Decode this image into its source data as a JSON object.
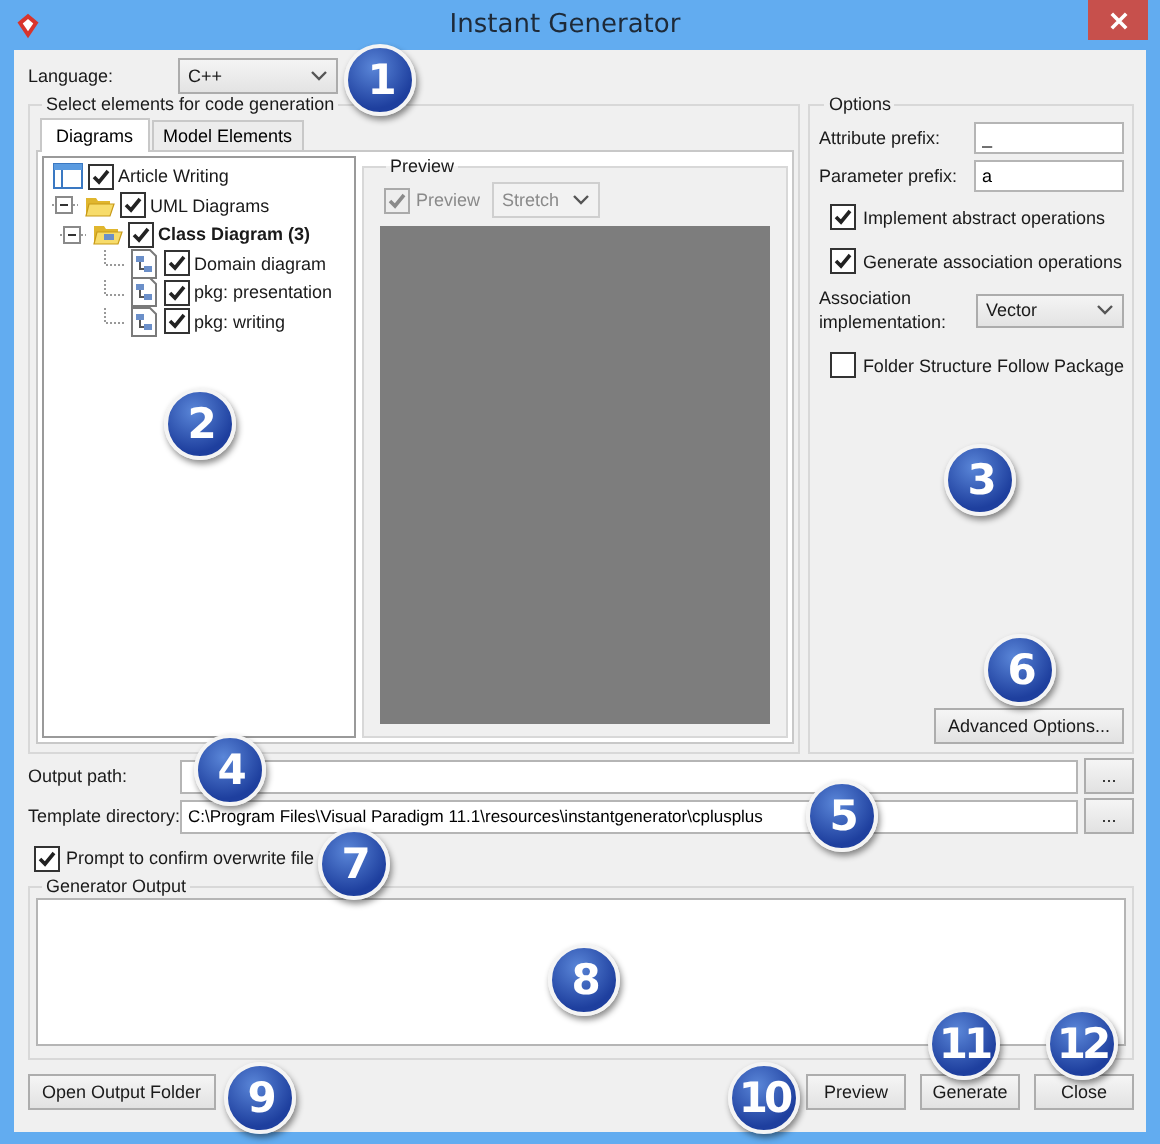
{
  "window": {
    "title": "Instant Generator"
  },
  "language": {
    "label": "Language:",
    "value": "C++"
  },
  "elements_group": {
    "title": "Select elements for code generation",
    "tabs": [
      {
        "label": "Diagrams",
        "selected": true
      },
      {
        "label": "Model Elements",
        "selected": false
      }
    ],
    "tree": [
      {
        "kind": "diagram",
        "label": "Article Writing",
        "checked": true
      },
      {
        "kind": "folder",
        "label": "UML Diagrams",
        "checked": true,
        "expanded": true,
        "children": [
          {
            "kind": "category",
            "label": "Class Diagram (3)",
            "checked": true,
            "expanded": true,
            "children": [
              {
                "kind": "class-diagram",
                "label": "Domain diagram",
                "checked": true
              },
              {
                "kind": "class-diagram",
                "label": "pkg: presentation",
                "checked": true
              },
              {
                "kind": "class-diagram",
                "label": "pkg: writing",
                "checked": true
              }
            ]
          }
        ]
      }
    ],
    "preview": {
      "title": "Preview",
      "checkbox": {
        "label": "Preview",
        "checked": true,
        "disabled": true
      },
      "mode": {
        "value": "Stretch",
        "disabled": true
      }
    }
  },
  "options": {
    "title": "Options",
    "fields": [
      {
        "label": "Attribute prefix:",
        "value": "_"
      },
      {
        "label": "Parameter prefix:",
        "value": "a"
      }
    ],
    "checkboxes": [
      {
        "label": "Implement abstract operations",
        "checked": true
      },
      {
        "label": "Generate association operations",
        "checked": true
      }
    ],
    "association": {
      "label": "Association implementation:",
      "value": "Vector"
    },
    "folder_checkbox": {
      "label": "Folder Structure Follow Package",
      "checked": false
    },
    "advanced_button": "Advanced Options..."
  },
  "output_path": {
    "label": "Output path:",
    "browse": "..."
  },
  "template_directory": {
    "label": "Template directory:",
    "value": "C:\\Program Files\\Visual Paradigm 11.1\\resources\\instantgenerator\\cplusplus",
    "browse": "..."
  },
  "overwrite": {
    "label": "Prompt to confirm overwrite file",
    "checked": true
  },
  "generator_output": {
    "title": "Generator Output"
  },
  "buttons_left": [
    "Open Output Folder"
  ],
  "buttons_right": [
    "Preview",
    "Generate",
    "Close"
  ],
  "callouts": [
    "1",
    "2",
    "3",
    "4",
    "5",
    "6",
    "7",
    "8",
    "9",
    "10",
    "11",
    "12"
  ]
}
